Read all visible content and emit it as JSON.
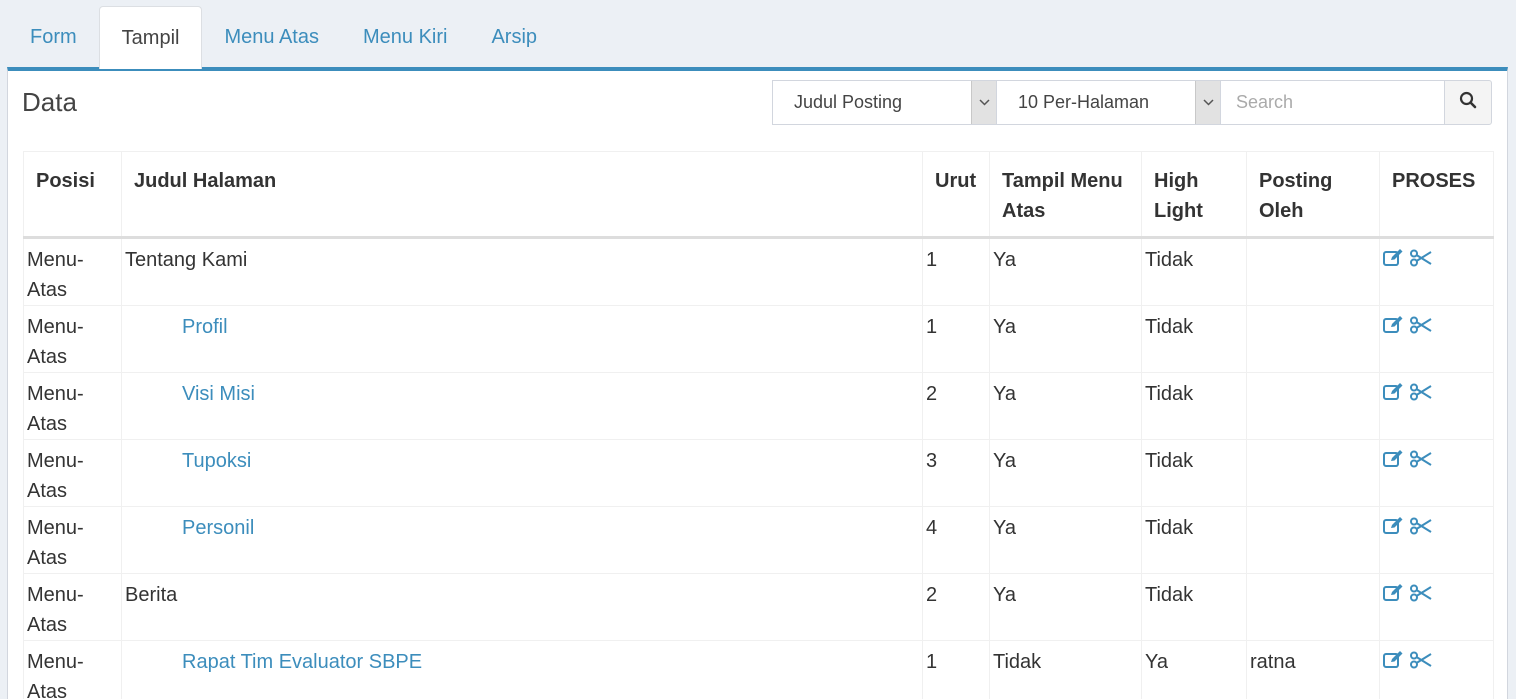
{
  "tabs": [
    "Form",
    "Tampil",
    "Menu Atas",
    "Menu Kiri",
    "Arsip"
  ],
  "active_tab": "Tampil",
  "panel": {
    "title": "Data",
    "filter_field": "Judul Posting",
    "per_page": "10 Per-Halaman",
    "search_placeholder": "Search"
  },
  "table": {
    "headers": [
      "Posisi",
      "Judul Halaman",
      "Urut",
      "Tampil Menu Atas",
      "High Light",
      "Posting Oleh",
      "PROSES"
    ],
    "rows": [
      {
        "posisi": "Menu-Atas",
        "judul": "Tentang Kami",
        "child": false,
        "urut": "1",
        "tampil": "Ya",
        "highlight": "Tidak",
        "oleh": ""
      },
      {
        "posisi": "Menu-Atas",
        "judul": "Profil",
        "child": true,
        "urut": "1",
        "tampil": "Ya",
        "highlight": "Tidak",
        "oleh": ""
      },
      {
        "posisi": "Menu-Atas",
        "judul": "Visi Misi",
        "child": true,
        "urut": "2",
        "tampil": "Ya",
        "highlight": "Tidak",
        "oleh": ""
      },
      {
        "posisi": "Menu-Atas",
        "judul": "Tupoksi",
        "child": true,
        "urut": "3",
        "tampil": "Ya",
        "highlight": "Tidak",
        "oleh": ""
      },
      {
        "posisi": "Menu-Atas",
        "judul": "Personil",
        "child": true,
        "urut": "4",
        "tampil": "Ya",
        "highlight": "Tidak",
        "oleh": ""
      },
      {
        "posisi": "Menu-Atas",
        "judul": "Berita",
        "child": false,
        "urut": "2",
        "tampil": "Ya",
        "highlight": "Tidak",
        "oleh": ""
      },
      {
        "posisi": "Menu-Atas",
        "judul": "Rapat Tim Evaluator SBPE",
        "child": true,
        "urut": "1",
        "tampil": "Tidak",
        "highlight": "Ya",
        "oleh": "ratna"
      }
    ]
  },
  "icons": {
    "edit": "edit-icon",
    "delete": "scissors-icon",
    "search": "search-icon",
    "dropdown": "chevron-down-icon"
  },
  "colors": {
    "accent": "#3c8dbc",
    "background": "#ecf0f5"
  }
}
